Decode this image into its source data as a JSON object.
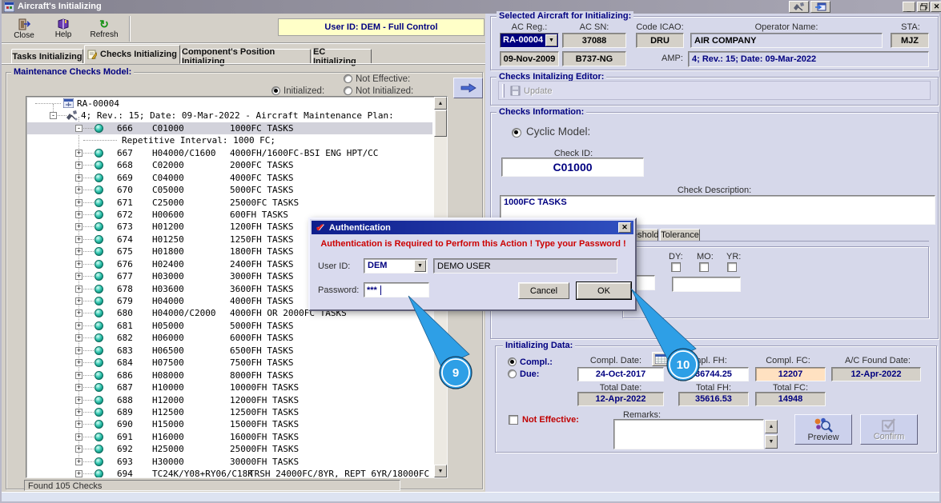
{
  "titlebar": {
    "title": "Aircraft's Initializing"
  },
  "toolbar": {
    "close": "Close",
    "help": "Help",
    "refresh": "Refresh",
    "banner": "User ID: DEM - Full Control"
  },
  "tabs": {
    "tasks": "Tasks Initializing",
    "checks": "Checks Initializing",
    "components": "Component's Position Initializing",
    "ec": "EC Initializing"
  },
  "maintenance": {
    "title": "Maintenance Checks Model:",
    "radio_not_effective": "Not Effective:",
    "radio_initialized": "Initialized:",
    "radio_not_initialized": "Not Initialized:",
    "status": "Found 105 Checks",
    "tree_root": "RA-00004",
    "tree_plan": "4; Rev.: 15; Date: 09-Mar-2022 - Aircraft Maintenance Plan:",
    "rows": [
      {
        "num": "666",
        "id": "C01000",
        "desc": "1000FC TASKS",
        "selected": true
      },
      {
        "interval": "Repetitive Interval:  1000 FC;"
      },
      {
        "num": "667",
        "id": "H04000/C1600",
        "desc": "4000FH/1600FC-BSI ENG HPT/CC"
      },
      {
        "num": "668",
        "id": "C02000",
        "desc": "2000FC TASKS"
      },
      {
        "num": "669",
        "id": "C04000",
        "desc": "4000FC TASKS"
      },
      {
        "num": "670",
        "id": "C05000",
        "desc": "5000FC TASKS"
      },
      {
        "num": "671",
        "id": "C25000",
        "desc": "25000FC TASKS"
      },
      {
        "num": "672",
        "id": "H00600",
        "desc": "600FH TASKS"
      },
      {
        "num": "673",
        "id": "H01200",
        "desc": "1200FH TASKS"
      },
      {
        "num": "674",
        "id": "H01250",
        "desc": "1250FH TASKS"
      },
      {
        "num": "675",
        "id": "H01800",
        "desc": "1800FH TASKS"
      },
      {
        "num": "676",
        "id": "H02400",
        "desc": "2400FH TASKS"
      },
      {
        "num": "677",
        "id": "H03000",
        "desc": "3000FH TASKS"
      },
      {
        "num": "678",
        "id": "H03600",
        "desc": "3600FH TASKS"
      },
      {
        "num": "679",
        "id": "H04000",
        "desc": "4000FH TASKS"
      },
      {
        "num": "680",
        "id": "H04000/C2000",
        "desc": "4000FH OR 2000FC TASKS"
      },
      {
        "num": "681",
        "id": "H05000",
        "desc": "5000FH TASKS"
      },
      {
        "num": "682",
        "id": "H06000",
        "desc": "6000FH TASKS"
      },
      {
        "num": "683",
        "id": "H06500",
        "desc": "6500FH TASKS"
      },
      {
        "num": "684",
        "id": "H07500",
        "desc": "7500FH TASKS"
      },
      {
        "num": "686",
        "id": "H08000",
        "desc": "8000FH TASKS"
      },
      {
        "num": "687",
        "id": "H10000",
        "desc": "10000FH TASKS"
      },
      {
        "num": "688",
        "id": "H12000",
        "desc": "12000FH TASKS"
      },
      {
        "num": "689",
        "id": "H12500",
        "desc": "12500FH TASKS"
      },
      {
        "num": "690",
        "id": "H15000",
        "desc": "15000FH TASKS"
      },
      {
        "num": "691",
        "id": "H16000",
        "desc": "16000FH TASKS"
      },
      {
        "num": "692",
        "id": "H25000",
        "desc": "25000FH TASKS"
      },
      {
        "num": "693",
        "id": "H30000",
        "desc": "30000FH TASKS"
      },
      {
        "num": "694",
        "id": "TC24K/Y08+RY06/C18K",
        "desc": "TRSH 24000FC/8YR, REPT 6YR/18000FC"
      }
    ]
  },
  "aircraft": {
    "title": "Selected Aircraft for Initializing:",
    "ac_reg_label": "AC Reg.:",
    "ac_reg": "RA-00004",
    "ac_sn_label": "AC SN:",
    "ac_sn": "37088",
    "icao_label": "Code ICAO:",
    "icao": "DRU",
    "operator_label": "Operator Name:",
    "operator": "AIR COMPANY",
    "sta_label": "STA:",
    "sta": "MJZ",
    "date": "09-Nov-2009",
    "type": "B737-NG",
    "amp_label": "AMP:",
    "amp": "4; Rev.: 15; Date: 09-Mar-2022"
  },
  "editor": {
    "title": "Checks Initalizing Editor:",
    "update": "Update"
  },
  "checks_info": {
    "title": "Checks Information:",
    "cyclic": "Cyclic Model:",
    "check_id_label": "Check ID:",
    "check_id": "C01000",
    "desc_label": "Check Description:",
    "desc": "1000FC TASKS",
    "tab_threshold": "Threshold",
    "tab_tolerance": "Tolerance",
    "dy": "DY:",
    "mo": "MO:",
    "yr": "YR:"
  },
  "initializing": {
    "title": "Initializing Data:",
    "compl": "Compl.:",
    "due": "Due:",
    "compl_date_label": "Compl. Date:",
    "compl_date": "24-Oct-2017",
    "compl_fh_label": "Compl. FH:",
    "compl_fh": "36744.25",
    "compl_fc_label": "Compl. FC:",
    "compl_fc": "12207",
    "found_date_label": "A/C Found Date:",
    "found_date": "12-Apr-2022",
    "total_date_label": "Total Date:",
    "total_date": "12-Apr-2022",
    "total_fh_label": "Total FH:",
    "total_fh": "35616.53",
    "total_fc_label": "Total FC:",
    "total_fc": "14948",
    "not_effective": "Not Effective:",
    "remarks_label": "Remarks:",
    "preview": "Preview",
    "confirm": "Confirm"
  },
  "dialog": {
    "title": "Authentication",
    "message": "Authentication is Required to Perform this Action ! Type your Password !",
    "user_id_label": "User ID:",
    "user_id": "DEM",
    "user_name": "DEMO USER",
    "password_label": "Password:",
    "password_mask": "***",
    "cancel": "Cancel",
    "ok": "OK"
  },
  "callouts": {
    "nine": "9",
    "ten": "10"
  },
  "icons": {
    "close": "exit-door",
    "help": "book",
    "refresh": "circular-arrow",
    "update": "floppy-disk",
    "calendar": "calendar-grid",
    "preview": "magnifier-molecules",
    "confirm": "checkmark",
    "dialog_title": "red-checkmark"
  },
  "colors": {
    "accent_blue": "#2e9fe6",
    "navy": "#000080",
    "alert_red": "#c00000",
    "panel_lavender": "#d6d8ea",
    "chrome_gray": "#d4d0c8",
    "highlight_orange": "#ffe1c1",
    "banner_yellow": "#ffffc8"
  }
}
